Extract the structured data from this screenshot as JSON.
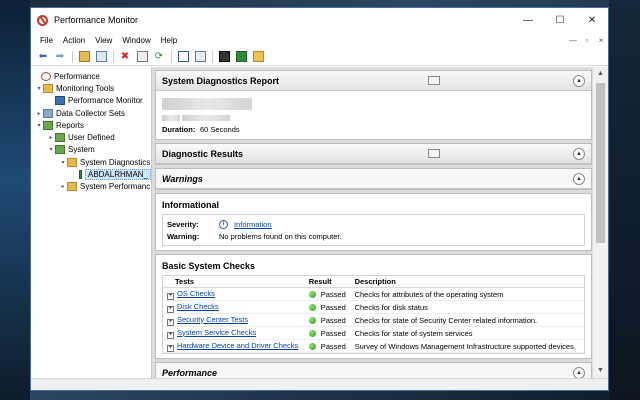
{
  "window": {
    "title": "Performance Monitor",
    "controls": {
      "minimize": "—",
      "maximize": "☐",
      "close": "✕"
    }
  },
  "menu": {
    "items": [
      "File",
      "Action",
      "View",
      "Window",
      "Help"
    ],
    "mdi_controls": [
      "—",
      "▫",
      "×"
    ]
  },
  "toolbar": {
    "icons": [
      "back-arrow-icon",
      "forward-arrow-icon",
      "up-folder-icon",
      "show-hide-console-tree-icon",
      "delete-icon",
      "properties-icon",
      "refresh-icon",
      "export-list-icon",
      "help-icon",
      "start-icon",
      "stop-icon",
      "new-icon"
    ]
  },
  "tree": {
    "performance": "Performance",
    "monitoring_tools": "Monitoring Tools",
    "performance_monitor": "Performance Monitor",
    "data_collector_sets": "Data Collector Sets",
    "reports": "Reports",
    "user_defined": "User Defined",
    "system": "System",
    "system_diagnostics": "System Diagnostics",
    "report_item": "ABDALRHMAN_",
    "system_performance": "System Performanc"
  },
  "report": {
    "sdr": {
      "title": "System Diagnostics Report",
      "duration_label": "Duration:",
      "duration_value": "60 Seconds"
    },
    "diagnostic_results": {
      "title": "Diagnostic Results"
    },
    "warnings": {
      "title": "Warnings"
    },
    "informational": {
      "title": "Informational",
      "severity_label": "Severity:",
      "severity_value": "Information",
      "warning_label": "Warning:",
      "warning_value": "No problems found on this computer."
    },
    "basic_checks": {
      "title": "Basic System Checks",
      "columns": [
        "Tests",
        "Result",
        "Description"
      ],
      "rows": [
        {
          "test": "OS Checks",
          "result": "Passed",
          "description": "Checks for attributes of the operating system"
        },
        {
          "test": "Disk Checks",
          "result": "Passed",
          "description": "Checks for disk status"
        },
        {
          "test": "Security Center Tests",
          "result": "Passed",
          "description": "Checks for state of Security Center related information."
        },
        {
          "test": "System Service Checks",
          "result": "Passed",
          "description": "Checks for state of system services"
        },
        {
          "test": "Hardware Device and Driver Checks",
          "result": "Passed",
          "description": "Survey of Windows Management Infrastructure supported devices."
        }
      ]
    },
    "performance": {
      "title": "Performance"
    }
  },
  "colors": {
    "accent": "#0645ad",
    "pass": "#2f9a1c",
    "selection": "#cde8ff"
  }
}
